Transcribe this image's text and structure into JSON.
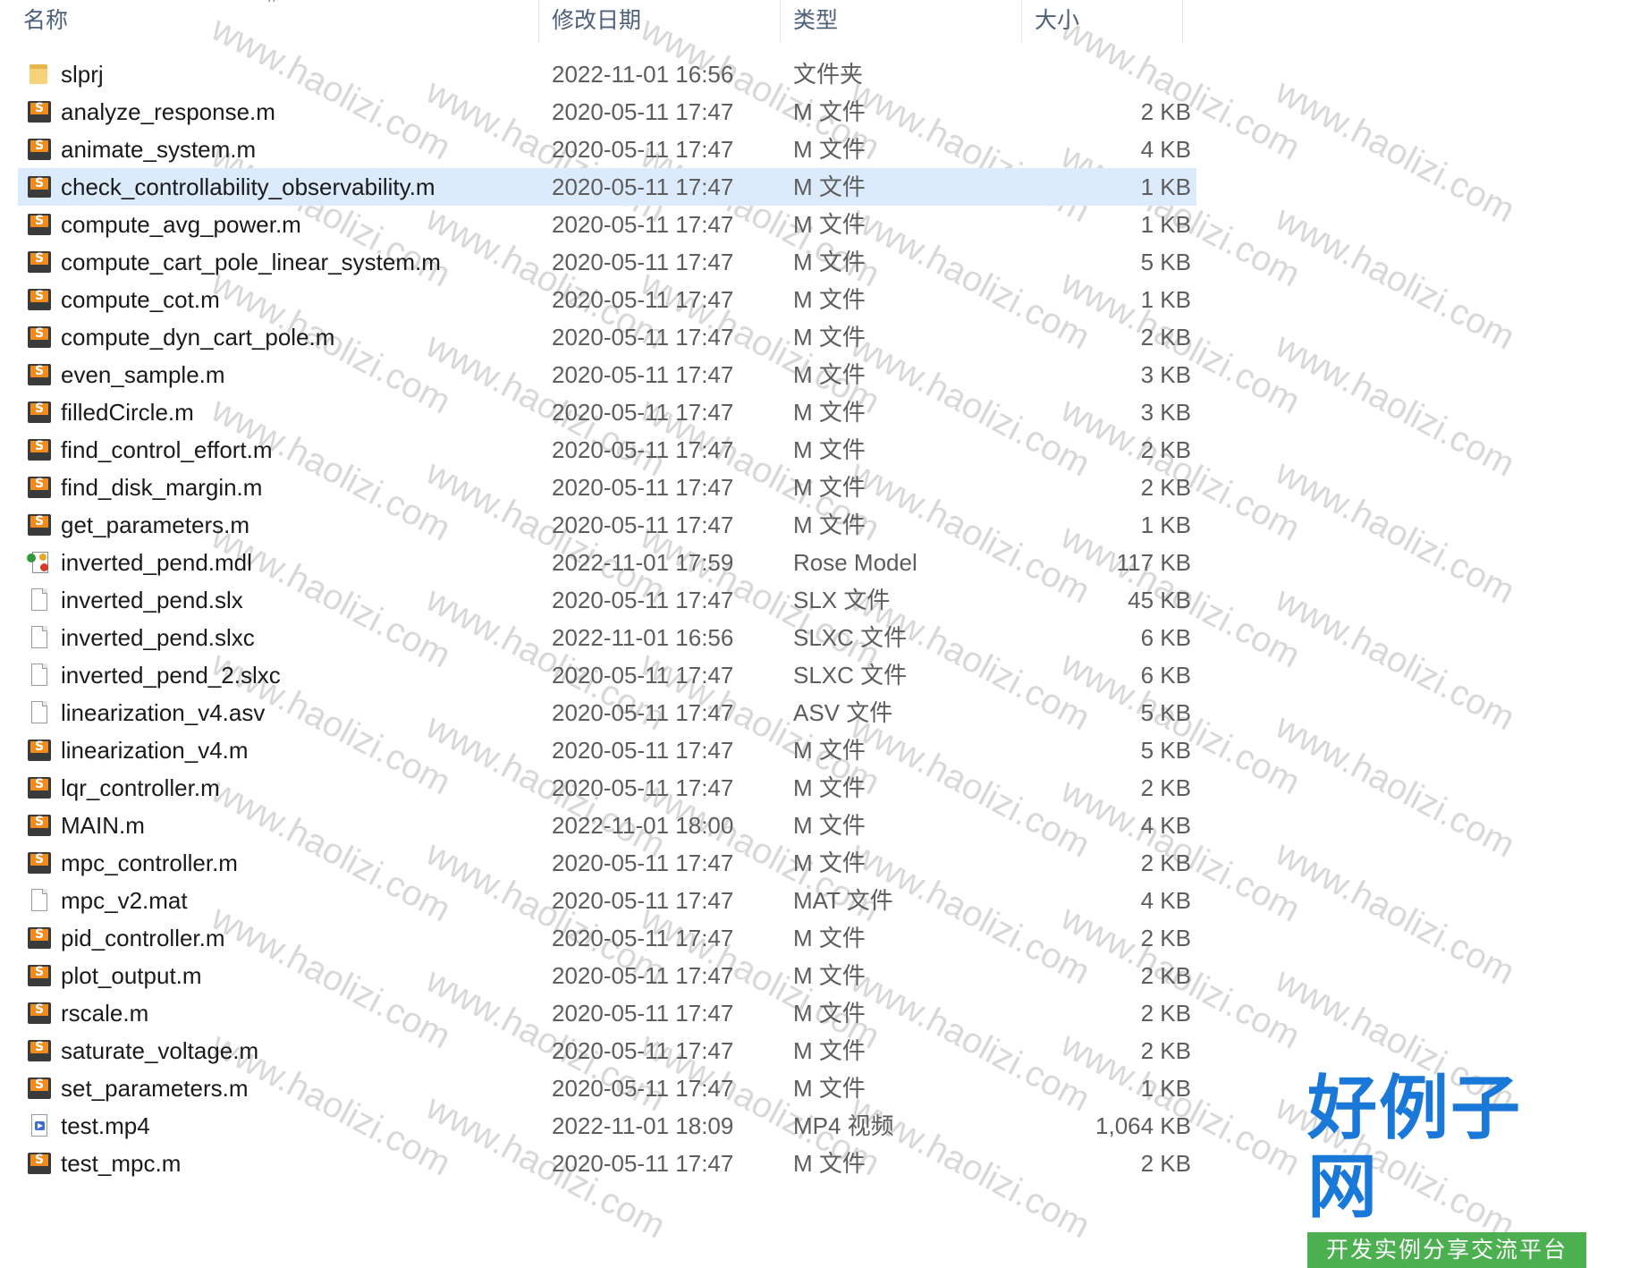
{
  "header": {
    "col_name": "名称",
    "col_date": "修改日期",
    "col_type": "类型",
    "col_size": "大小",
    "sort_indicator": "^"
  },
  "files": [
    {
      "name": "slprj",
      "date": "2022-11-01 16:56",
      "type": "文件夹",
      "size": "",
      "icon": "folder-icon"
    },
    {
      "name": "analyze_response.m",
      "date": "2020-05-11 17:47",
      "type": "M 文件",
      "size": "2 KB",
      "icon": "matlab-file-icon"
    },
    {
      "name": "animate_system.m",
      "date": "2020-05-11 17:47",
      "type": "M 文件",
      "size": "4 KB",
      "icon": "matlab-file-icon"
    },
    {
      "name": "check_controllability_observability.m",
      "date": "2020-05-11 17:47",
      "type": "M 文件",
      "size": "1 KB",
      "icon": "matlab-file-icon",
      "selected": true
    },
    {
      "name": "compute_avg_power.m",
      "date": "2020-05-11 17:47",
      "type": "M 文件",
      "size": "1 KB",
      "icon": "matlab-file-icon"
    },
    {
      "name": "compute_cart_pole_linear_system.m",
      "date": "2020-05-11 17:47",
      "type": "M 文件",
      "size": "5 KB",
      "icon": "matlab-file-icon"
    },
    {
      "name": "compute_cot.m",
      "date": "2020-05-11 17:47",
      "type": "M 文件",
      "size": "1 KB",
      "icon": "matlab-file-icon"
    },
    {
      "name": "compute_dyn_cart_pole.m",
      "date": "2020-05-11 17:47",
      "type": "M 文件",
      "size": "2 KB",
      "icon": "matlab-file-icon"
    },
    {
      "name": "even_sample.m",
      "date": "2020-05-11 17:47",
      "type": "M 文件",
      "size": "3 KB",
      "icon": "matlab-file-icon"
    },
    {
      "name": "filledCircle.m",
      "date": "2020-05-11 17:47",
      "type": "M 文件",
      "size": "3 KB",
      "icon": "matlab-file-icon"
    },
    {
      "name": "find_control_effort.m",
      "date": "2020-05-11 17:47",
      "type": "M 文件",
      "size": "2 KB",
      "icon": "matlab-file-icon"
    },
    {
      "name": "find_disk_margin.m",
      "date": "2020-05-11 17:47",
      "type": "M 文件",
      "size": "2 KB",
      "icon": "matlab-file-icon"
    },
    {
      "name": "get_parameters.m",
      "date": "2020-05-11 17:47",
      "type": "M 文件",
      "size": "1 KB",
      "icon": "matlab-file-icon"
    },
    {
      "name": "inverted_pend.mdl",
      "date": "2022-11-01 17:59",
      "type": "Rose Model",
      "size": "117 KB",
      "icon": "rose-model-icon"
    },
    {
      "name": "inverted_pend.slx",
      "date": "2020-05-11 17:47",
      "type": "SLX 文件",
      "size": "45 KB",
      "icon": "blank-file-icon"
    },
    {
      "name": "inverted_pend.slxc",
      "date": "2022-11-01 16:56",
      "type": "SLXC 文件",
      "size": "6 KB",
      "icon": "blank-file-icon"
    },
    {
      "name": "inverted_pend_2.slxc",
      "date": "2020-05-11 17:47",
      "type": "SLXC 文件",
      "size": "6 KB",
      "icon": "blank-file-icon"
    },
    {
      "name": "linearization_v4.asv",
      "date": "2020-05-11 17:47",
      "type": "ASV 文件",
      "size": "5 KB",
      "icon": "blank-file-icon"
    },
    {
      "name": "linearization_v4.m",
      "date": "2020-05-11 17:47",
      "type": "M 文件",
      "size": "5 KB",
      "icon": "matlab-file-icon"
    },
    {
      "name": "lqr_controller.m",
      "date": "2020-05-11 17:47",
      "type": "M 文件",
      "size": "2 KB",
      "icon": "matlab-file-icon"
    },
    {
      "name": "MAIN.m",
      "date": "2022-11-01 18:00",
      "type": "M 文件",
      "size": "4 KB",
      "icon": "matlab-file-icon"
    },
    {
      "name": "mpc_controller.m",
      "date": "2020-05-11 17:47",
      "type": "M 文件",
      "size": "2 KB",
      "icon": "matlab-file-icon"
    },
    {
      "name": "mpc_v2.mat",
      "date": "2020-05-11 17:47",
      "type": "MAT 文件",
      "size": "4 KB",
      "icon": "blank-file-icon"
    },
    {
      "name": "pid_controller.m",
      "date": "2020-05-11 17:47",
      "type": "M 文件",
      "size": "2 KB",
      "icon": "matlab-file-icon"
    },
    {
      "name": "plot_output.m",
      "date": "2020-05-11 17:47",
      "type": "M 文件",
      "size": "2 KB",
      "icon": "matlab-file-icon"
    },
    {
      "name": "rscale.m",
      "date": "2020-05-11 17:47",
      "type": "M 文件",
      "size": "2 KB",
      "icon": "matlab-file-icon"
    },
    {
      "name": "saturate_voltage.m",
      "date": "2020-05-11 17:47",
      "type": "M 文件",
      "size": "2 KB",
      "icon": "matlab-file-icon"
    },
    {
      "name": "set_parameters.m",
      "date": "2020-05-11 17:47",
      "type": "M 文件",
      "size": "1 KB",
      "icon": "matlab-file-icon"
    },
    {
      "name": "test.mp4",
      "date": "2022-11-01 18:09",
      "type": "MP4 视频",
      "size": "1,064 KB",
      "icon": "video-file-icon"
    },
    {
      "name": "test_mpc.m",
      "date": "2020-05-11 17:47",
      "type": "M 文件",
      "size": "2 KB",
      "icon": "matlab-file-icon"
    }
  ],
  "watermark": {
    "text": "www.haolizi.com"
  },
  "logo": {
    "title": "好例子网",
    "subtitle": "开发实例分享交流平台"
  },
  "colors": {
    "selected_row": "#dcebfc",
    "header_text": "#4c607a",
    "matlab_orange": "#f08c1e",
    "logo_blue": "#1a78d8",
    "logo_green": "#4caf50"
  }
}
